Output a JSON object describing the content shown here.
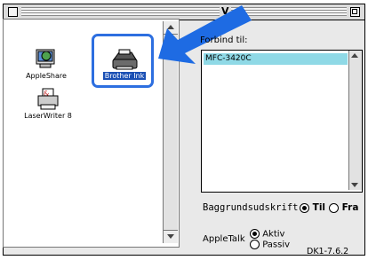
{
  "window": {
    "title": "V"
  },
  "left_panel": {
    "icons": [
      {
        "label": "AppleShare",
        "icon": "appleshare-globe-icon"
      },
      {
        "label": "Brother Ink",
        "icon": "brother-printer-icon",
        "selected": true
      },
      {
        "label": "LaserWriter 8",
        "icon": "laserwriter-icon"
      }
    ]
  },
  "right_panel": {
    "connect_label": "Forbind til:",
    "printers": [
      "MFC-3420C"
    ],
    "background_print_label": "Baggrundsudskrift:",
    "bg_on": "Til",
    "bg_off": "Fra",
    "appletalk_label": "AppleTalk",
    "at_active": "Aktiv",
    "at_passive": "Passiv"
  },
  "footer_code": "DK1-7.6.2",
  "colors": {
    "selection_frame": "#2d6fe0",
    "list_highlight": "#8fd9e6",
    "arrow": "#1e6be3"
  }
}
